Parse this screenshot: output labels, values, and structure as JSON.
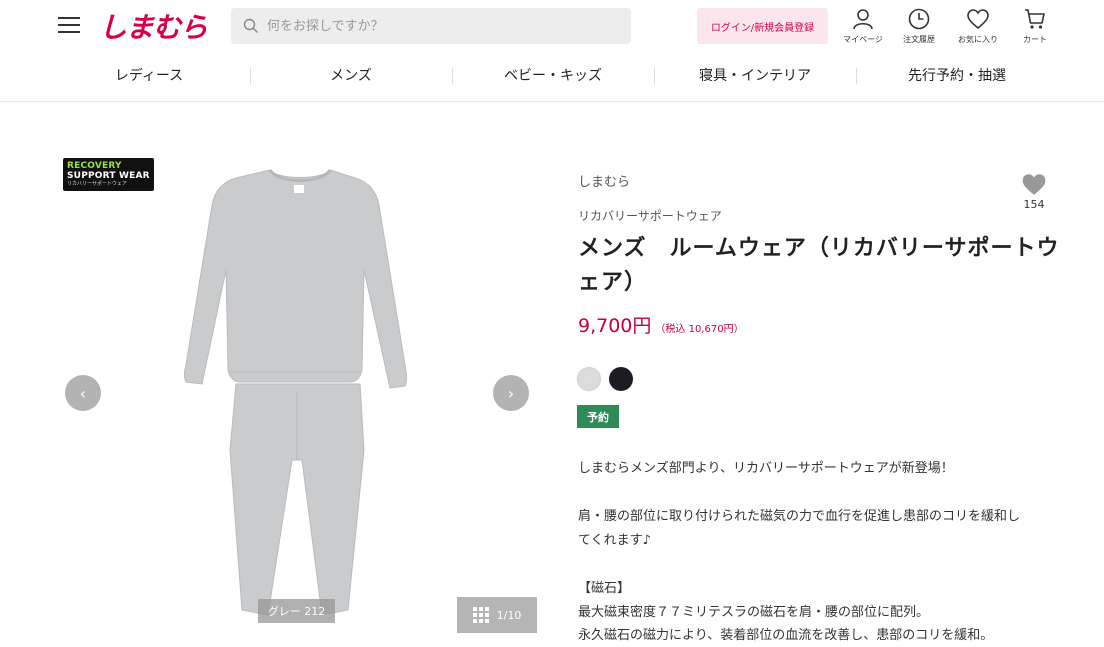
{
  "header": {
    "logo": "しまむら",
    "search_placeholder": "何をお探しですか？",
    "login_label": "ログイン/新規会員登録",
    "icons": [
      {
        "name": "user-icon",
        "label": "マイページ"
      },
      {
        "name": "clock-icon",
        "label": "注文履歴"
      },
      {
        "name": "heart-icon",
        "label": "お気に入り"
      },
      {
        "name": "cart-icon",
        "label": "カート"
      }
    ]
  },
  "nav": [
    "レディース",
    "メンズ",
    "ベビー・キッズ",
    "寝具・インテリア",
    "先行予約・抽選"
  ],
  "gallery": {
    "badge": {
      "line1": "RECOVERY",
      "line2": "SUPPORT WEAR",
      "line3": "リカバリーサポートウェア"
    },
    "color_caption": "グレー 212",
    "counter": "1/10",
    "prev_arrow": "‹",
    "next_arrow": "›"
  },
  "product": {
    "brand": "しまむら",
    "category": "リカバリーサポートウェア",
    "title": "メンズ　ルームウェア（リカバリーサポートウェア）",
    "price": "9,700円",
    "price_tax": "（税込 10,670円）",
    "favorite_count": "154",
    "swatches": [
      {
        "name": "gray",
        "color": "#dcdcdc"
      },
      {
        "name": "black",
        "color": "#1c1d22"
      }
    ],
    "tag": "予約",
    "tag_color": "#2e8b57",
    "description": [
      "しまむらメンズ部門より、リカバリーサポートウェアが新登場！",
      "肩・腰の部位に取り付けられた磁気の力で血行を促進し患部のコリを緩和し",
      "てくれます♪",
      "【磁石】",
      "最大磁束密度７７ミリテスラの磁石を肩・腰の部位に配列。",
      "永久磁石の磁力により、装着部位の血流を改善し、患部のコリを緩和。"
    ]
  },
  "colors": {
    "brand": "#d6004a",
    "price": "#c6003f"
  }
}
